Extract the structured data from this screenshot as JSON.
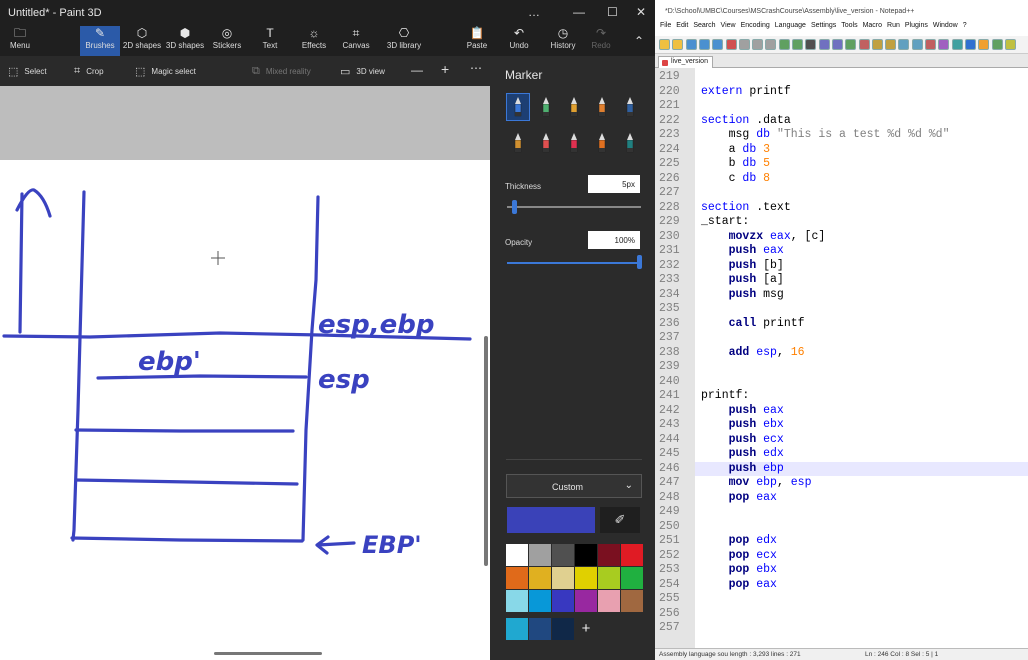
{
  "paint": {
    "title": "Untitled* - Paint 3D",
    "window_controls": [
      "…",
      "—",
      "☐",
      "✕"
    ],
    "ribbon": [
      {
        "label": "Menu",
        "icon": "folder-icon",
        "glyph": "🗀"
      },
      {
        "label": "Brushes",
        "icon": "brush-icon",
        "glyph": "✎",
        "active": true
      },
      {
        "label": "2D shapes",
        "icon": "2d-shapes-icon",
        "glyph": "⬡"
      },
      {
        "label": "3D shapes",
        "icon": "3d-shapes-icon",
        "glyph": "⬢"
      },
      {
        "label": "Stickers",
        "icon": "stickers-icon",
        "glyph": "◎"
      },
      {
        "label": "Text",
        "icon": "text-icon",
        "glyph": "T"
      },
      {
        "label": "Effects",
        "icon": "effects-icon",
        "glyph": "☼"
      },
      {
        "label": "Canvas",
        "icon": "canvas-icon",
        "glyph": "⌗"
      },
      {
        "label": "3D library",
        "icon": "3d-library-icon",
        "glyph": "⎔"
      },
      {
        "label": "Paste",
        "icon": "paste-icon",
        "glyph": "📋"
      },
      {
        "label": "Undo",
        "icon": "undo-icon",
        "glyph": "↶"
      },
      {
        "label": "History",
        "icon": "history-icon",
        "glyph": "◷"
      },
      {
        "label": "Redo",
        "icon": "redo-icon",
        "glyph": "↷",
        "disabled": true
      }
    ],
    "toolbar": {
      "select": "Select",
      "crop": "Crop",
      "magic_select": "Magic select",
      "mixed_reality": "Mixed reality",
      "view_3d": "3D view",
      "zoom_out": "—",
      "zoom_in": "+",
      "more": "⋯"
    },
    "side": {
      "title": "Marker",
      "thickness_label": "Thickness",
      "thickness_value": "5px",
      "thickness_fraction": 0.05,
      "opacity_label": "Opacity",
      "opacity_value": "100%",
      "opacity_fraction": 1.0,
      "custom_label": "Custom",
      "current_color": "#3a42b8",
      "palette": [
        "#ffffff",
        "#a0a0a0",
        "#505050",
        "#000000",
        "#7a1020",
        "#e01b24",
        "#e06a1a",
        "#e0b020",
        "#e0d090",
        "#e0d000",
        "#a8cc20",
        "#20b040",
        "#88d8e8",
        "#0898d8",
        "#3838c0",
        "#9828a0",
        "#e8a0b0",
        "#a06840"
      ],
      "recent": [
        "#20a8d0",
        "#204880",
        "#102848"
      ],
      "brushes": [
        {
          "name": "marker-brush-icon",
          "color": "#3b78d8"
        },
        {
          "name": "calligraphy-pen-icon",
          "color": "#4fb070"
        },
        {
          "name": "oil-brush-icon",
          "color": "#e0a030"
        },
        {
          "name": "watercolor-icon",
          "color": "#e08030"
        },
        {
          "name": "pixel-pen-icon",
          "color": "#3060a0"
        },
        {
          "name": "pencil-icon",
          "color": "#d09030"
        },
        {
          "name": "eraser-icon",
          "color": "#e05050"
        },
        {
          "name": "crayon-icon",
          "color": "#e03050"
        },
        {
          "name": "spray-can-icon",
          "color": "#e07020"
        },
        {
          "name": "fill-icon",
          "color": "#208080"
        }
      ]
    },
    "drawing_text": {
      "label_esp_ebp": "esp,ebp",
      "label_ebp1": "ebp'",
      "label_esp": "esp",
      "label_EBP1": "EBP'"
    }
  },
  "notepad": {
    "title": "*D:\\School\\UMBC\\Courses\\MSCrashCourse\\Assembly\\live_version - Notepad++",
    "menu": [
      "File",
      "Edit",
      "Search",
      "View",
      "Encoding",
      "Language",
      "Settings",
      "Tools",
      "Macro",
      "Run",
      "Plugins",
      "Window",
      "?"
    ],
    "tab": "live_version",
    "lines": [
      {
        "n": "219",
        "html": ""
      },
      {
        "n": "220",
        "html": "<span class='kw'>extern</span> printf"
      },
      {
        "n": "221",
        "html": ""
      },
      {
        "n": "222",
        "html": "<span class='kw'>section</span> .data"
      },
      {
        "n": "223",
        "html": "    msg <span class='kw'>db</span> <span class='str'>\"This is a test %d %d %d\"</span>"
      },
      {
        "n": "224",
        "html": "    a <span class='kw'>db</span> <span class='num'>3</span>"
      },
      {
        "n": "225",
        "html": "    b <span class='kw'>db</span> <span class='num'>5</span>"
      },
      {
        "n": "226",
        "html": "    c <span class='kw'>db</span> <span class='num'>8</span>"
      },
      {
        "n": "227",
        "html": ""
      },
      {
        "n": "228",
        "html": "<span class='kw'>section</span> .text"
      },
      {
        "n": "229",
        "html": "_start:"
      },
      {
        "n": "230",
        "html": "    <span class='kw2'>movzx</span> <span class='reg'>eax</span>, [c]"
      },
      {
        "n": "231",
        "html": "    <span class='kw2'>push</span> <span class='reg'>eax</span>"
      },
      {
        "n": "232",
        "html": "    <span class='kw2'>push</span> [b]"
      },
      {
        "n": "233",
        "html": "    <span class='kw2'>push</span> [a]"
      },
      {
        "n": "234",
        "html": "    <span class='kw2'>push</span> msg"
      },
      {
        "n": "235",
        "html": ""
      },
      {
        "n": "236",
        "html": "    <span class='kw2'>call</span> printf"
      },
      {
        "n": "237",
        "html": ""
      },
      {
        "n": "238",
        "html": "    <span class='kw2'>add</span> <span class='reg'>esp</span>, <span class='num'>16</span>"
      },
      {
        "n": "239",
        "html": ""
      },
      {
        "n": "240",
        "html": ""
      },
      {
        "n": "241",
        "html": "printf:"
      },
      {
        "n": "242",
        "html": "    <span class='kw2'>push</span> <span class='reg'>eax</span>"
      },
      {
        "n": "243",
        "html": "    <span class='kw2'>push</span> <span class='reg'>ebx</span>"
      },
      {
        "n": "244",
        "html": "    <span class='kw2'>push</span> <span class='reg'>ecx</span>"
      },
      {
        "n": "245",
        "html": "    <span class='kw2'>push</span> <span class='reg'>edx</span>"
      },
      {
        "n": "246",
        "html": "    <span class='kw2'>push</span> <span class='reg'>ebp</span>",
        "hl": true
      },
      {
        "n": "247",
        "html": "    <span class='kw2'>mov</span> <span class='reg'>ebp</span>, <span class='reg'>esp</span>"
      },
      {
        "n": "248",
        "html": "    <span class='kw2'>pop</span> <span class='reg'>eax</span>"
      },
      {
        "n": "249",
        "html": ""
      },
      {
        "n": "250",
        "html": ""
      },
      {
        "n": "251",
        "html": "    <span class='kw2'>pop</span> <span class='reg'>edx</span>"
      },
      {
        "n": "252",
        "html": "    <span class='kw2'>pop</span> <span class='reg'>ecx</span>"
      },
      {
        "n": "253",
        "html": "    <span class='kw2'>pop</span> <span class='reg'>ebx</span>"
      },
      {
        "n": "254",
        "html": "    <span class='kw2'>pop</span> <span class='reg'>eax</span>"
      },
      {
        "n": "255",
        "html": ""
      },
      {
        "n": "256",
        "html": ""
      },
      {
        "n": "257",
        "html": ""
      }
    ],
    "status": {
      "left": "Assembly language sou length : 3,293   lines : 271",
      "mid": "Ln : 246   Col : 8   Sel : 5 | 1"
    }
  }
}
